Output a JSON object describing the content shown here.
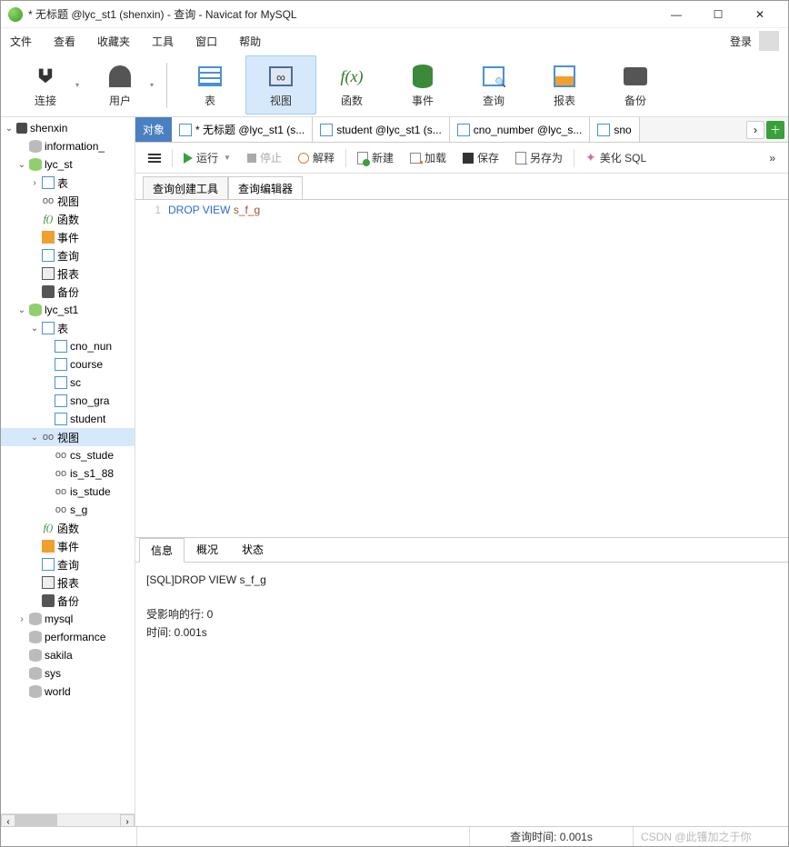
{
  "window": {
    "title": "* 无标题 @lyc_st1 (shenxin) - 查询 - Navicat for MySQL"
  },
  "menu": {
    "items": [
      "文件",
      "查看",
      "收藏夹",
      "工具",
      "窗口",
      "帮助"
    ],
    "login": "登录"
  },
  "toolbar": {
    "items": [
      {
        "label": "连接",
        "icon": "plug"
      },
      {
        "label": "用户",
        "icon": "user"
      },
      {
        "label": "表",
        "icon": "table"
      },
      {
        "label": "视图",
        "icon": "view",
        "active": true
      },
      {
        "label": "函数",
        "icon": "fx"
      },
      {
        "label": "事件",
        "icon": "db"
      },
      {
        "label": "查询",
        "icon": "query"
      },
      {
        "label": "报表",
        "icon": "report"
      },
      {
        "label": "备份",
        "icon": "backup"
      }
    ]
  },
  "tree": [
    {
      "indent": 0,
      "toggle": "v",
      "icon": "conn-dark",
      "label": "shenxin"
    },
    {
      "indent": 1,
      "toggle": "",
      "icon": "dbcyl grey",
      "label": "information_"
    },
    {
      "indent": 1,
      "toggle": "v",
      "icon": "dbcyl",
      "label": "lyc_st"
    },
    {
      "indent": 2,
      "toggle": ">",
      "icon": "tbl",
      "label": "表"
    },
    {
      "indent": 2,
      "toggle": "",
      "icon": "view",
      "label": "视图"
    },
    {
      "indent": 2,
      "toggle": "",
      "icon": "fx",
      "label": "函数"
    },
    {
      "indent": 2,
      "toggle": "",
      "icon": "evt",
      "label": "事件"
    },
    {
      "indent": 2,
      "toggle": "",
      "icon": "qry",
      "label": "查询"
    },
    {
      "indent": 2,
      "toggle": "",
      "icon": "rpt",
      "label": "报表"
    },
    {
      "indent": 2,
      "toggle": "",
      "icon": "bak",
      "label": "备份"
    },
    {
      "indent": 1,
      "toggle": "v",
      "icon": "dbcyl",
      "label": "lyc_st1"
    },
    {
      "indent": 2,
      "toggle": "v",
      "icon": "tbl",
      "label": "表"
    },
    {
      "indent": 3,
      "toggle": "",
      "icon": "tbl",
      "label": "cno_nun"
    },
    {
      "indent": 3,
      "toggle": "",
      "icon": "tbl",
      "label": "course"
    },
    {
      "indent": 3,
      "toggle": "",
      "icon": "tbl",
      "label": "sc"
    },
    {
      "indent": 3,
      "toggle": "",
      "icon": "tbl",
      "label": "sno_gra"
    },
    {
      "indent": 3,
      "toggle": "",
      "icon": "tbl",
      "label": "student"
    },
    {
      "indent": 2,
      "toggle": "v",
      "icon": "view",
      "label": "视图",
      "sel": true
    },
    {
      "indent": 3,
      "toggle": "",
      "icon": "view",
      "label": "cs_stude"
    },
    {
      "indent": 3,
      "toggle": "",
      "icon": "view",
      "label": "is_s1_88"
    },
    {
      "indent": 3,
      "toggle": "",
      "icon": "view",
      "label": "is_stude"
    },
    {
      "indent": 3,
      "toggle": "",
      "icon": "view",
      "label": "s_g"
    },
    {
      "indent": 2,
      "toggle": "",
      "icon": "fx",
      "label": "函数"
    },
    {
      "indent": 2,
      "toggle": "",
      "icon": "evt",
      "label": "事件"
    },
    {
      "indent": 2,
      "toggle": "",
      "icon": "qry",
      "label": "查询"
    },
    {
      "indent": 2,
      "toggle": "",
      "icon": "rpt",
      "label": "报表"
    },
    {
      "indent": 2,
      "toggle": "",
      "icon": "bak",
      "label": "备份"
    },
    {
      "indent": 1,
      "toggle": ">",
      "icon": "dbcyl grey",
      "label": "mysql"
    },
    {
      "indent": 1,
      "toggle": "",
      "icon": "dbcyl grey",
      "label": "performance"
    },
    {
      "indent": 1,
      "toggle": "",
      "icon": "dbcyl grey",
      "label": "sakila"
    },
    {
      "indent": 1,
      "toggle": "",
      "icon": "dbcyl grey",
      "label": "sys"
    },
    {
      "indent": 1,
      "toggle": "",
      "icon": "dbcyl grey",
      "label": "world"
    }
  ],
  "tabs": {
    "pinned": "对象",
    "items": [
      {
        "icon": "qry",
        "label": "* 无标题 @lyc_st1 (s..."
      },
      {
        "icon": "tbl",
        "label": "student @lyc_st1 (s..."
      },
      {
        "icon": "tbl",
        "label": "cno_number @lyc_s..."
      },
      {
        "icon": "tbl",
        "label": "sno"
      }
    ]
  },
  "query_toolbar": {
    "run": "运行",
    "stop": "停止",
    "explain": "解释",
    "new": "新建",
    "load": "加载",
    "save": "保存",
    "save_as": "另存为",
    "beautify": "美化 SQL"
  },
  "subtabs": {
    "builder": "查询创建工具",
    "editor": "查询编辑器"
  },
  "sql": {
    "line_no": "1",
    "kw1": "DROP",
    "kw2": "VIEW",
    "ident": "s_f_g"
  },
  "result_tabs": [
    "信息",
    "概况",
    "状态"
  ],
  "output": {
    "line1": "[SQL]DROP VIEW s_f_g",
    "line2": "受影响的行: 0",
    "line3": "时间: 0.001s"
  },
  "status": {
    "query_time": "查询时间: 0.001s",
    "watermark": "CSDN @此镬加之于你"
  }
}
